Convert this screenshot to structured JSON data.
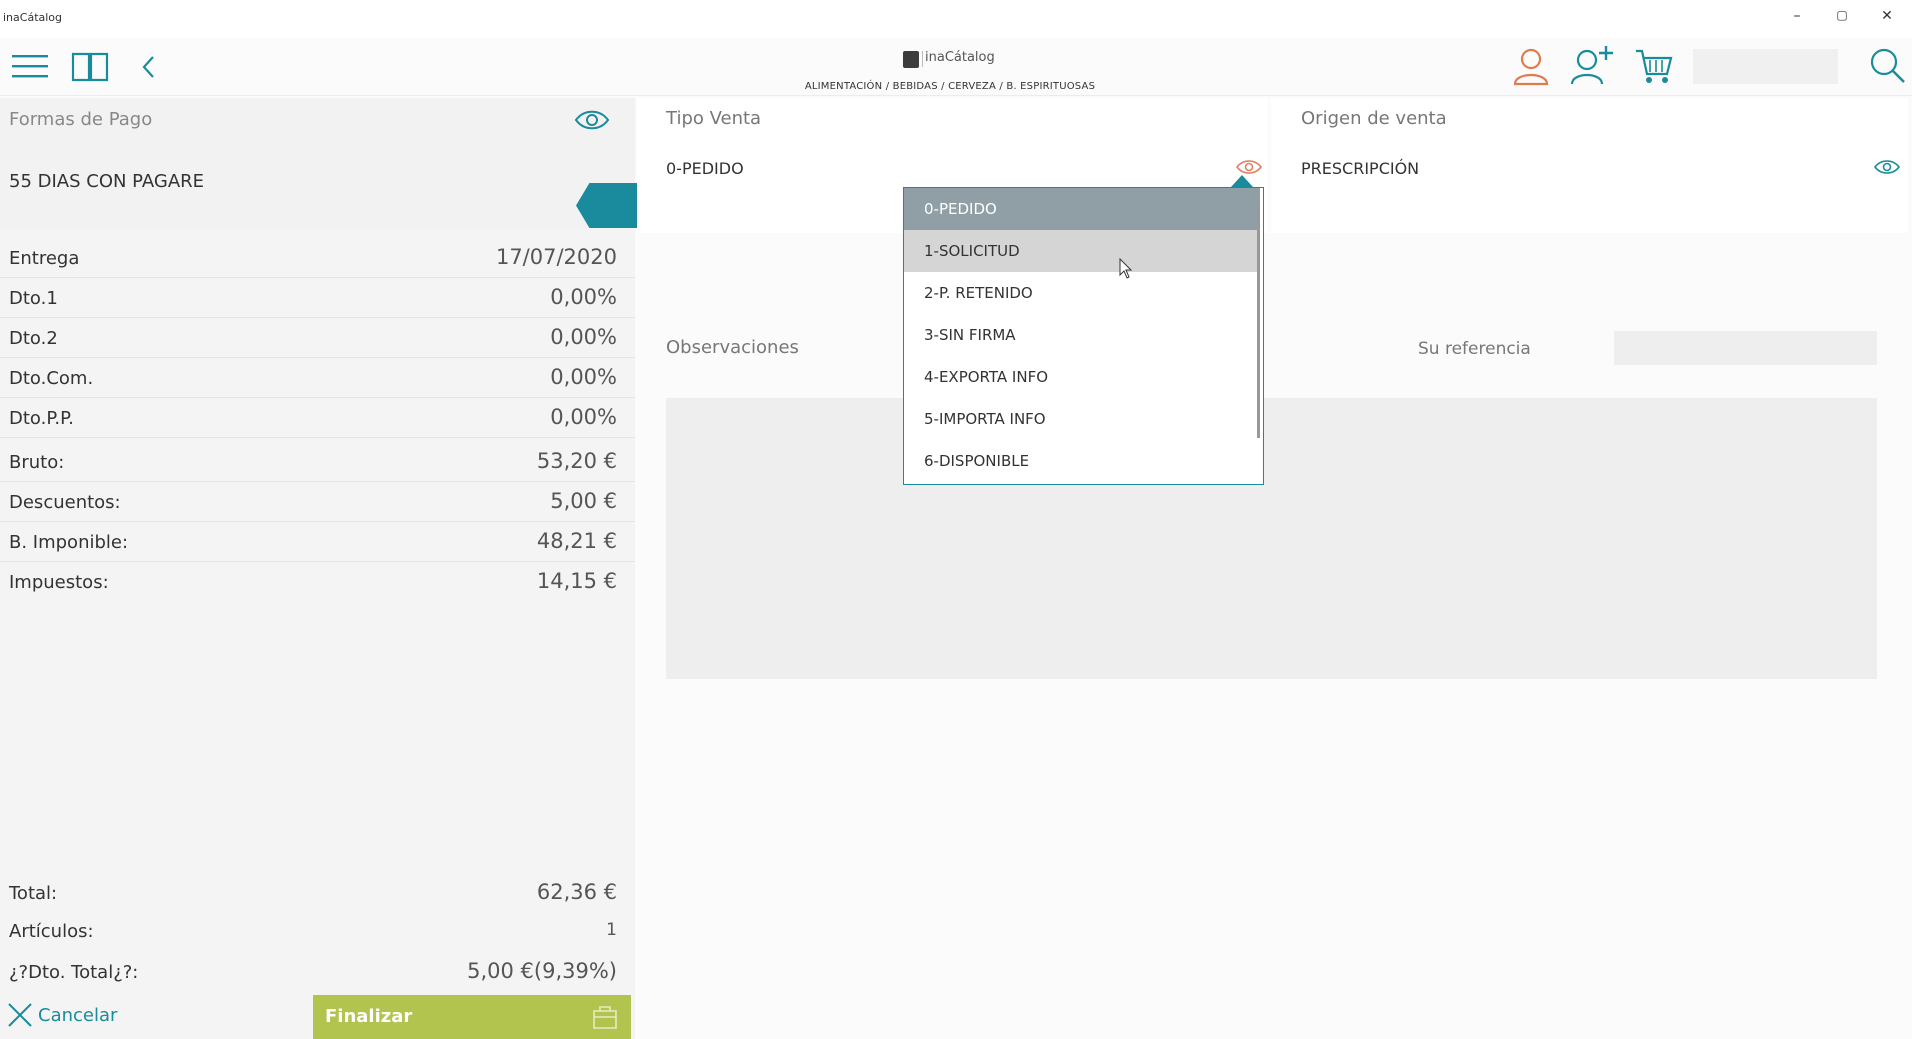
{
  "window": {
    "title": "inaCátalog",
    "minimize": "–",
    "maximize": "▢",
    "close": "✕"
  },
  "header": {
    "logo_text": "inaCátalog",
    "breadcrumb": "ALIMENTACIÓN / BEBIDAS / CERVEZA / B. ESPIRITUOSAS"
  },
  "left": {
    "payment_label": "Formas de Pago",
    "payment_value": "55 DIAS CON PAGARE",
    "rows": [
      {
        "label": "Entrega",
        "value": "17/07/2020"
      },
      {
        "label": "Dto.1",
        "value": "0,00%"
      },
      {
        "label": "Dto.2",
        "value": "0,00%"
      },
      {
        "label": "Dto.Com.",
        "value": "0,00%"
      },
      {
        "label": "Dto.P.P.",
        "value": "0,00%"
      },
      {
        "label": "Bruto:",
        "value": "53,20 €"
      },
      {
        "label": "Descuentos:",
        "value": "5,00 €"
      },
      {
        "label": "B. Imponible:",
        "value": "48,21 €"
      },
      {
        "label": "Impuestos:",
        "value": "14,15 €"
      }
    ],
    "totals": [
      {
        "label": "Total:",
        "value": "62,36 €"
      },
      {
        "label": "Artículos:",
        "value": "1"
      },
      {
        "label": "¿?Dto. Total¿?:",
        "value": "5,00 €(9,39%)"
      }
    ],
    "cancel_label": "Cancelar",
    "finish_label": "Finalizar"
  },
  "tipo_venta": {
    "label": "Tipo Venta",
    "value": "0-PEDIDO",
    "options": [
      "0-PEDIDO",
      "1-SOLICITUD",
      "2-P. RETENIDO",
      "3-SIN FIRMA",
      "4-EXPORTA INFO",
      "5-IMPORTA INFO",
      "6-DISPONIBLE"
    ],
    "selected_index": 0,
    "hover_index": 1
  },
  "origen_venta": {
    "label": "Origen de venta",
    "value": "PRESCRIPCIÓN"
  },
  "observaciones": {
    "label": "Observaciones",
    "value": ""
  },
  "su_referencia": {
    "label": "Su referencia",
    "value": ""
  },
  "colors": {
    "accent": "#1a8b9c",
    "finish_button": "#b2c44d",
    "user_icon": "#e07b50",
    "eye_icon_alert": "#e08060"
  }
}
